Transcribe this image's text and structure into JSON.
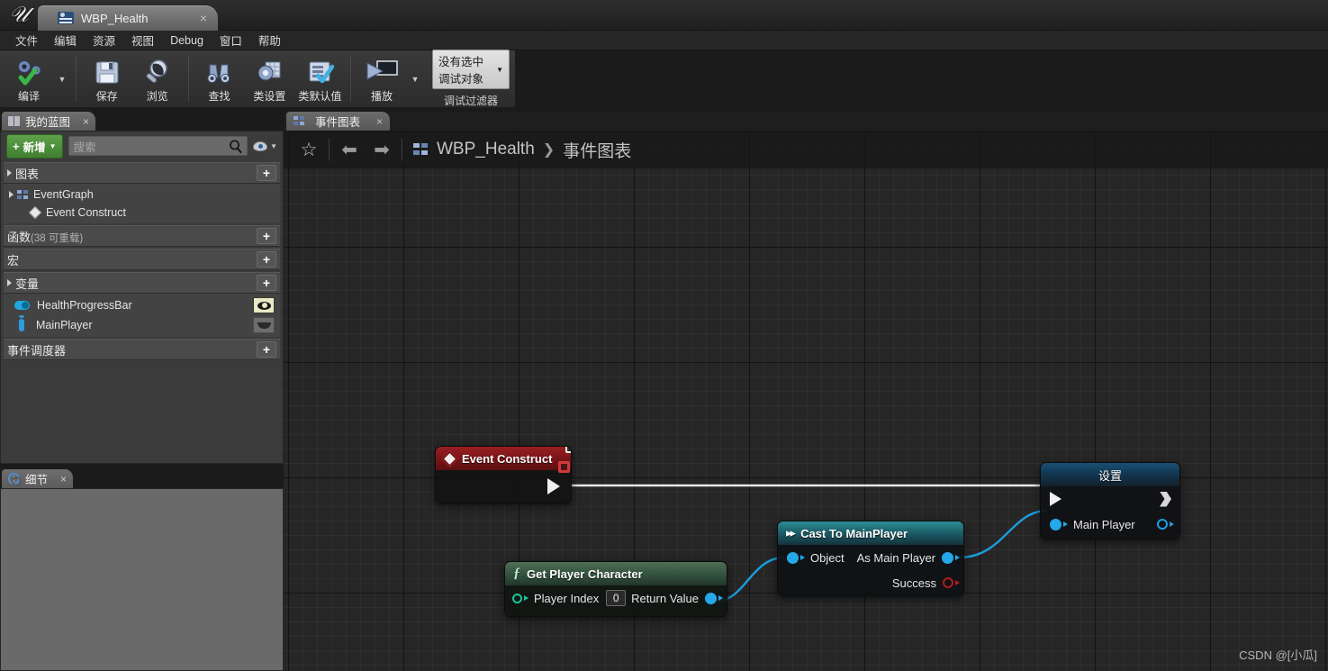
{
  "window": {
    "logo": "unreal-engine-logo",
    "tab_label": "WBP_Health",
    "tab_close": "×"
  },
  "menubar": {
    "items": [
      {
        "label": "文件"
      },
      {
        "label": "编辑"
      },
      {
        "label": "资源"
      },
      {
        "label": "视图"
      },
      {
        "label": "Debug"
      },
      {
        "label": "窗口"
      },
      {
        "label": "帮助"
      }
    ]
  },
  "toolbar": {
    "compile": "编译",
    "save": "保存",
    "browse": "浏览",
    "find": "查找",
    "class_settings": "类设置",
    "class_defaults": "类默认值",
    "play": "播放",
    "debug_object": "没有选中调试对象",
    "debug_filter": "调试过滤器",
    "dropdown_caret": "▾"
  },
  "my_blueprint": {
    "tab_title": "我的蓝图",
    "tab_close": "×",
    "add_button": "新增",
    "add_plus": "➕",
    "search_placeholder": "搜索",
    "sections": {
      "graphs": {
        "title": "图表",
        "plus": "+",
        "items": [
          {
            "label": "EventGraph",
            "icon": "event-graph-icon"
          },
          {
            "label": "Event Construct",
            "icon": "event-node-icon"
          }
        ]
      },
      "functions": {
        "title": "函数",
        "suffix": "(38 可重载)",
        "plus": "+"
      },
      "macros": {
        "title": "宏",
        "plus": "+"
      },
      "variables": {
        "title": "变量",
        "plus": "+",
        "items": [
          {
            "label": "HealthProgressBar",
            "icon": "bool-variable-icon",
            "visibility": "eye-visible-icon"
          },
          {
            "label": "MainPlayer",
            "icon": "object-variable-icon",
            "visibility": "eye-hidden-icon"
          }
        ]
      },
      "event_dispatchers": {
        "title": "事件调度器",
        "plus": "+"
      }
    }
  },
  "details": {
    "tab_title": "细节",
    "tab_close": "×"
  },
  "graph_panel": {
    "tab_title": "事件图表",
    "tab_close": "×",
    "toolbar": {
      "favorite": "☆",
      "back": "⬅",
      "forward": "➡"
    },
    "breadcrumb": {
      "icon": "blueprint-icon",
      "root": "WBP_Health",
      "separator": "❯",
      "current": "事件图表"
    }
  },
  "nodes": {
    "event_construct": {
      "title": "Event Construct",
      "badge": "event-screen-icon",
      "exec_out": "exec-output-pin"
    },
    "get_player_character": {
      "title": "Get Player Character",
      "fx": "ƒ",
      "input_label": "Player Index",
      "input_value": "0",
      "output_label": "Return Value"
    },
    "cast_to_main_player": {
      "title": "Cast To MainPlayer",
      "input_label": "Object",
      "output_label": "As Main Player",
      "exec_out_label": "Success"
    },
    "set_node": {
      "title": "设置",
      "property_label": "Main Player"
    }
  },
  "watermark": "CSDN @[小瓜]",
  "colors": {
    "accent_green": "#4f8f3c",
    "event_red": "#7a1518",
    "cast_teal": "#1c5f6a",
    "set_blue": "#123a56",
    "exec_white": "#f0f0f0",
    "object_blue": "#25a8ea",
    "int_green": "#19c79a",
    "bool_red": "#b01c1c"
  }
}
